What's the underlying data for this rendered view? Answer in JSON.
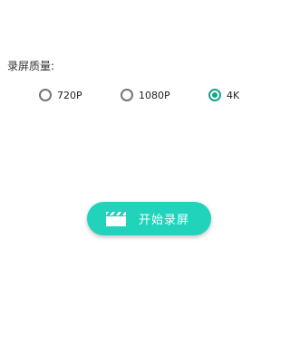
{
  "settings": {
    "quality_label": "录屏质量:",
    "options": [
      {
        "label": "720P",
        "selected": false
      },
      {
        "label": "1080P",
        "selected": false
      },
      {
        "label": "4K",
        "selected": true
      }
    ],
    "accent_color": "#19a38a"
  },
  "action": {
    "start_label": "开始录屏",
    "icon": "clapperboard-icon",
    "button_color": "#21d3bb"
  }
}
